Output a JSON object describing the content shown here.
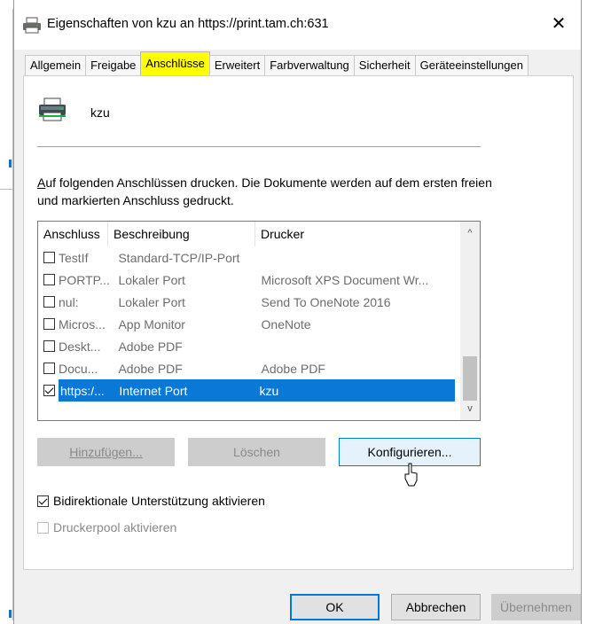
{
  "window": {
    "title": "Eigenschaften von kzu an https://print.tam.ch:631",
    "close_symbol": "✕"
  },
  "tabs": [
    {
      "label": "Allgemein"
    },
    {
      "label": "Freigabe"
    },
    {
      "label": "Anschlüsse",
      "active": true
    },
    {
      "label": "Erweitert"
    },
    {
      "label": "Farbverwaltung"
    },
    {
      "label": "Sicherheit"
    },
    {
      "label": "Geräteeinstellungen"
    }
  ],
  "printer": {
    "name": "kzu",
    "icon": "printer-icon"
  },
  "description": {
    "first_letter": "A",
    "rest": "uf folgenden Anschlüssen drucken. Die Dokumente werden auf dem ersten freien und markierten Anschluss gedruckt."
  },
  "ports_table": {
    "headers": [
      "Anschluss",
      "Beschreibung",
      "Drucker"
    ],
    "rows": [
      {
        "port": "TestIf",
        "description": "Standard-TCP/IP-Port",
        "printer": "",
        "checked": false
      },
      {
        "port": "PORTP...",
        "description": "Lokaler Port",
        "printer": "Microsoft XPS Document Wr...",
        "checked": false
      },
      {
        "port": "nul:",
        "description": "Lokaler Port",
        "printer": "Send To OneNote 2016",
        "checked": false
      },
      {
        "port": "Micros...",
        "description": "App Monitor",
        "printer": "OneNote",
        "checked": false
      },
      {
        "port": "Deskt...",
        "description": "Adobe PDF",
        "printer": "",
        "checked": false
      },
      {
        "port": "Docu...",
        "description": "Adobe PDF",
        "printer": "Adobe PDF",
        "checked": false
      },
      {
        "port": "https:/...",
        "description": "Internet Port",
        "printer": "kzu",
        "checked": true,
        "selected": true
      }
    ],
    "scroll_up": "^",
    "scroll_down": "v"
  },
  "buttons": {
    "add": "Hinzufügen...",
    "delete": "Löschen",
    "configure": "Konfigurieren..."
  },
  "options": {
    "bidirectional": {
      "label": "Bidirektionale Unterstützung aktivieren",
      "checked": true
    },
    "printer_pool": {
      "label": "Druckerpool aktivieren",
      "checked": false
    }
  },
  "footer": {
    "ok": "OK",
    "cancel": "Abbrechen",
    "apply": "Übernehmen"
  },
  "colors": {
    "highlight_tab": "#ffff00",
    "selection": "#0a78d7",
    "focus": "#0078d7"
  }
}
